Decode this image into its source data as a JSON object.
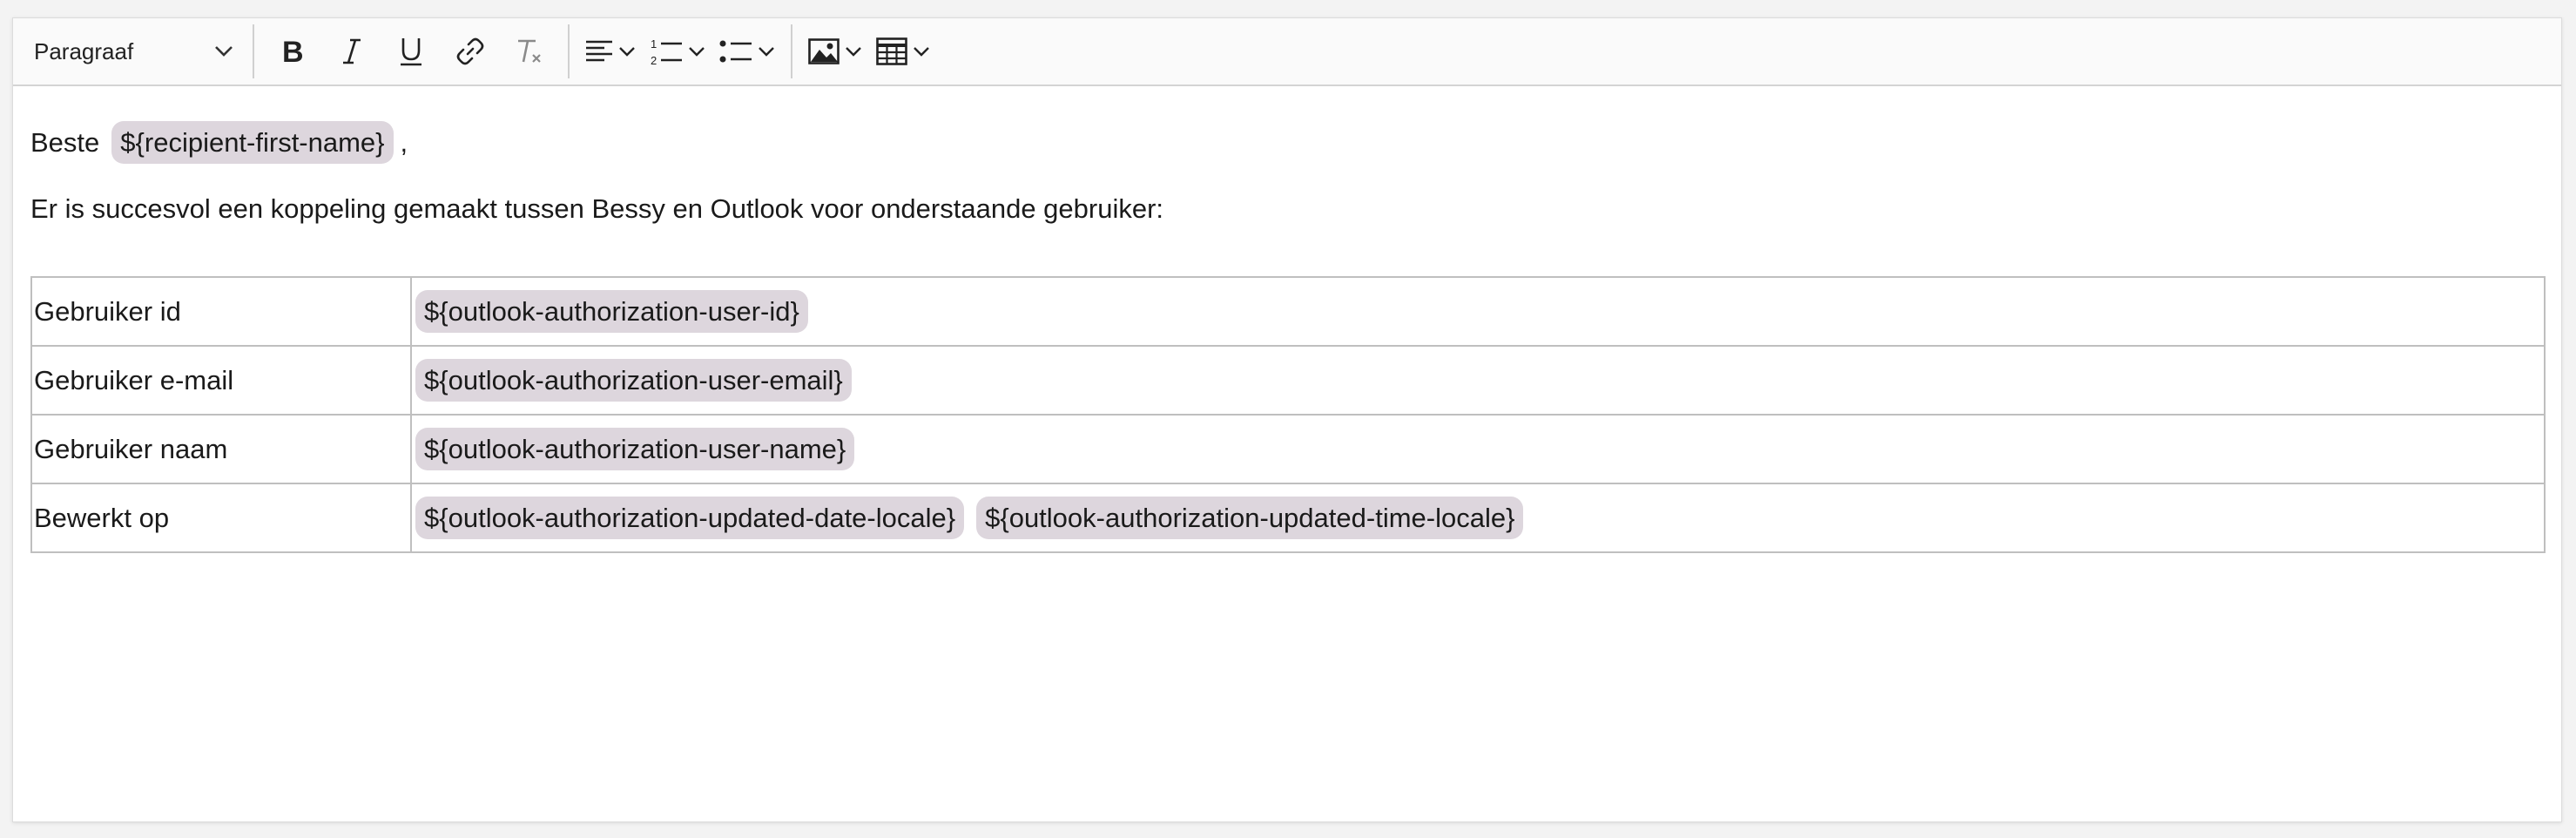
{
  "toolbar": {
    "block_format": "Paragraaf",
    "buttons": [
      {
        "name": "bold-button",
        "icon": "bold-icon"
      },
      {
        "name": "italic-button",
        "icon": "italic-icon"
      },
      {
        "name": "underline-button",
        "icon": "underline-icon"
      },
      {
        "name": "link-button",
        "icon": "link-icon"
      },
      {
        "name": "clear-format-button",
        "icon": "clear-format-icon"
      },
      {
        "name": "align-button",
        "icon": "align-left-icon"
      },
      {
        "name": "numbered-list-button",
        "icon": "numbered-list-icon"
      },
      {
        "name": "bulleted-list-button",
        "icon": "bulleted-list-icon"
      },
      {
        "name": "image-button",
        "icon": "image-icon"
      },
      {
        "name": "table-button",
        "icon": "table-icon"
      }
    ]
  },
  "content": {
    "greeting_prefix": "Beste",
    "greeting_placeholder": "${recipient-first-name}",
    "greeting_suffix": ",",
    "intro": "Er is succesvol een koppeling gemaakt tussen Bessy en Outlook voor onderstaande gebruiker:",
    "rows": [
      {
        "key": "Gebruiker id",
        "values": [
          "${outlook-authorization-user-id}"
        ]
      },
      {
        "key": "Gebruiker e-mail",
        "values": [
          "${outlook-authorization-user-email}"
        ]
      },
      {
        "key": "Gebruiker naam",
        "values": [
          "${outlook-authorization-user-name}"
        ]
      },
      {
        "key": "Bewerkt op",
        "values": [
          "${outlook-authorization-updated-date-locale}",
          "${outlook-authorization-updated-time-locale}"
        ]
      }
    ]
  },
  "colors": {
    "placeholder_bg": "#ddd6dd",
    "table_border": "#bfbfbf"
  }
}
